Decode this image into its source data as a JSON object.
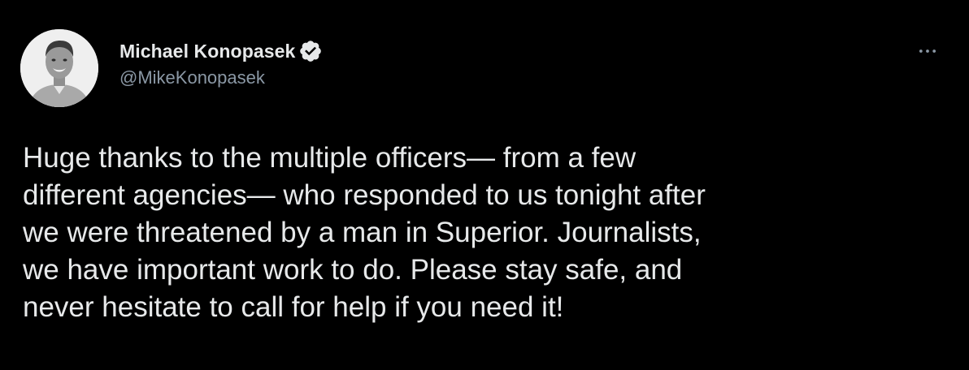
{
  "author": {
    "display_name": "Michael Konopasek",
    "handle": "@MikeKonopasek",
    "verified": true
  },
  "tweet": {
    "text": "Huge thanks to the multiple officers— from a few\ndifferent agencies— who responded to us tonight after\nwe were threatened by a man in Superior. Journalists,\nwe have important work to do. Please stay safe, and\nnever hesitate to call for help if you need it!"
  },
  "icons": {
    "verified": "verified-badge-icon",
    "more": "more-options-icon"
  },
  "colors": {
    "background": "#000000",
    "text_primary": "#e7e9ea",
    "text_secondary": "#8b98a5"
  }
}
